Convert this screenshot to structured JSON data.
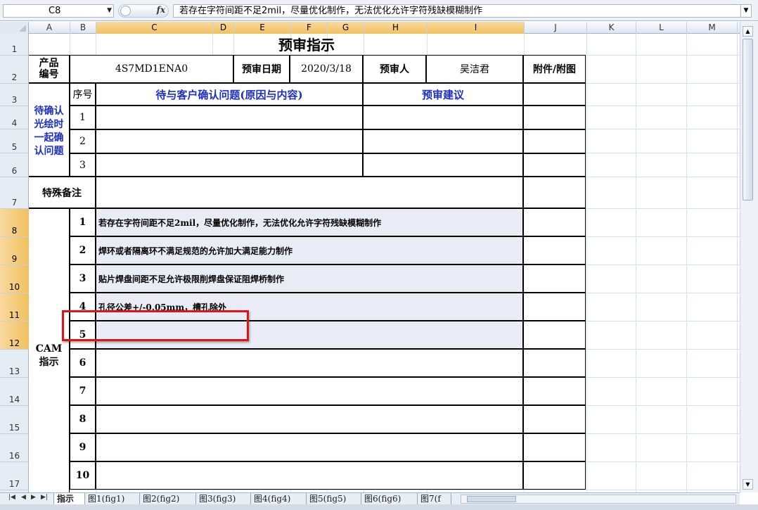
{
  "formula_bar": {
    "name_box": "C8",
    "fx_label": "fx",
    "formula": "若存在字符间距不足2mil，尽量优化制作，无法优化允许字符残缺模糊制作"
  },
  "columns": [
    "A",
    "B",
    "C",
    "D",
    "E",
    "F",
    "G",
    "H",
    "I",
    "J",
    "K",
    "L",
    "M"
  ],
  "rows": [
    "1",
    "2",
    "3",
    "4",
    "5",
    "6",
    "7",
    "8",
    "9",
    "10",
    "11",
    "12",
    "13",
    "14",
    "15",
    "16",
    "17"
  ],
  "sheet": {
    "title": "预审指示",
    "product_label": "产品\n编号",
    "product_no": "4S7MD1ENA0",
    "review_date_label": "预审日期",
    "review_date": "2020/3/18",
    "reviewer_label": "预审人",
    "reviewer": "吴洁君",
    "attachment_label": "附件/附图",
    "seq_label": "序号",
    "issues_label": "待与客户确认问题(原因与内容)",
    "suggestion_label": "预审建议",
    "pending_label": "待确认\n光绘时\n一起确\n认问题",
    "pending_rows": [
      "1",
      "2",
      "3"
    ],
    "remarks_label": "特殊备注",
    "cam_label": "CAM\n指示",
    "cam_rows": [
      {
        "no": "1",
        "text": "若存在字符间距不足2mil，尽量优化制作，无法优化允许字符残缺模糊制作"
      },
      {
        "no": "2",
        "text": "焊环或者隔离环不满足规范的允许加大满足能力制作"
      },
      {
        "no": "3",
        "text": "贴片焊盘间距不足允许极限削焊盘保证阻焊桥制作"
      },
      {
        "no": "4",
        "text": "孔径公差+/-0.05mm，槽孔除外"
      },
      {
        "no": "5",
        "text": ""
      },
      {
        "no": "6",
        "text": ""
      },
      {
        "no": "7",
        "text": ""
      },
      {
        "no": "8",
        "text": ""
      },
      {
        "no": "9",
        "text": ""
      },
      {
        "no": "10",
        "text": ""
      }
    ]
  },
  "tabs": [
    "指示",
    "图1(fig1)",
    "图2(fig2)",
    "图3(fig3)",
    "图4(fig4)",
    "图5(fig5)",
    "图6(fig6)",
    "图7(f"
  ],
  "colors": {
    "highlight": "#e9ecf4",
    "annotation": "#e01414",
    "header_blue": "#1c2fbf"
  }
}
